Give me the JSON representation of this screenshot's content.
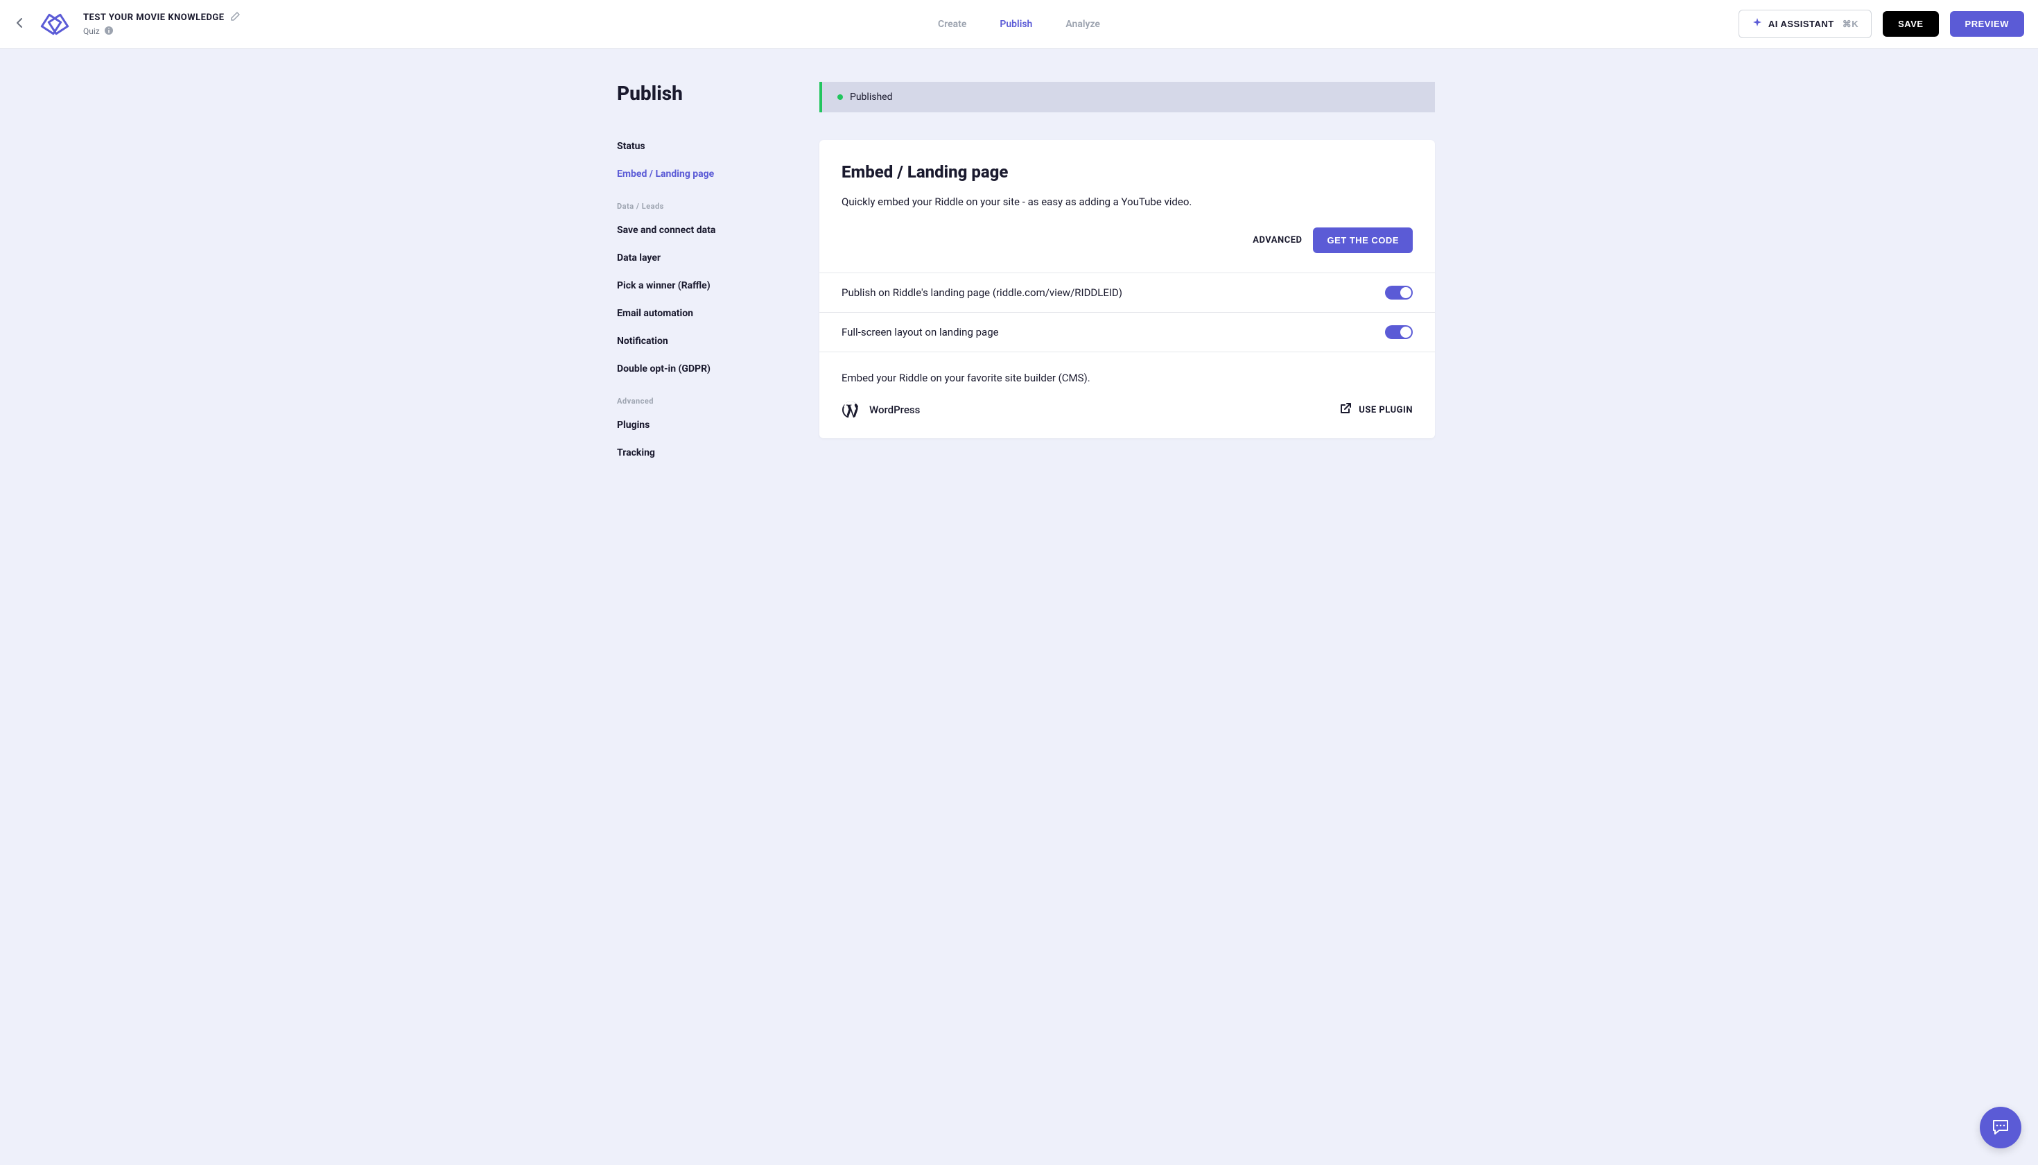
{
  "header": {
    "title": "TEST YOUR MOVIE KNOWLEDGE",
    "subtitle": "Quiz",
    "nav": {
      "create": "Create",
      "publish": "Publish",
      "analyze": "Analyze"
    },
    "ai_assistant": "AI ASSISTANT",
    "ai_shortcut": "⌘K",
    "save": "SAVE",
    "preview": "PREVIEW"
  },
  "sidebar": {
    "title": "Publish",
    "items": {
      "status": "Status",
      "embed": "Embed / Landing page",
      "section_data": "Data / Leads",
      "save_connect": "Save and connect data",
      "data_layer": "Data layer",
      "raffle": "Pick a winner (Raffle)",
      "email": "Email automation",
      "notification": "Notification",
      "gdpr": "Double opt-in (GDPR)",
      "section_advanced": "Advanced",
      "plugins": "Plugins",
      "tracking": "Tracking"
    }
  },
  "status": {
    "text": "Published"
  },
  "card": {
    "title": "Embed / Landing page",
    "desc": "Quickly embed your Riddle on your site - as easy as adding a YouTube video.",
    "advanced": "ADVANCED",
    "get_code": "GET THE CODE",
    "toggle1": "Publish on Riddle's landing page (riddle.com/view/RIDDLEID)",
    "toggle2": "Full-screen layout on landing page",
    "cms_desc": "Embed your Riddle on your favorite site builder (CMS).",
    "wordpress": "WordPress",
    "use_plugin": "USE PLUGIN"
  }
}
